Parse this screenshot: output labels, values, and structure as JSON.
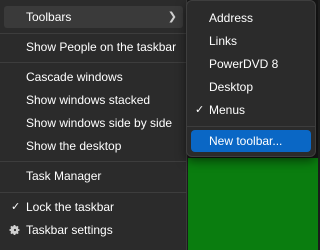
{
  "menu": {
    "toolbars": "Toolbars",
    "show_people": "Show People on the taskbar",
    "cascade": "Cascade windows",
    "stacked": "Show windows stacked",
    "side_by_side": "Show windows side by side",
    "show_desktop": "Show the desktop",
    "task_manager": "Task Manager",
    "lock_taskbar": "Lock the taskbar",
    "taskbar_settings": "Taskbar settings"
  },
  "submenu": {
    "address": "Address",
    "links": "Links",
    "powerdvd": "PowerDVD 8",
    "desktop": "Desktop",
    "menus": "Menus",
    "new_toolbar": "New toolbar..."
  },
  "icons": {
    "submenu_arrow": "chevron-right-icon",
    "check": "checkmark-icon",
    "settings": "gear-icon"
  },
  "colors": {
    "menu_bg": "#2b2b2b",
    "highlight": "#3a3a3a",
    "selection_blue": "#0a67c5",
    "desktop_green": "#0a7d0f"
  }
}
